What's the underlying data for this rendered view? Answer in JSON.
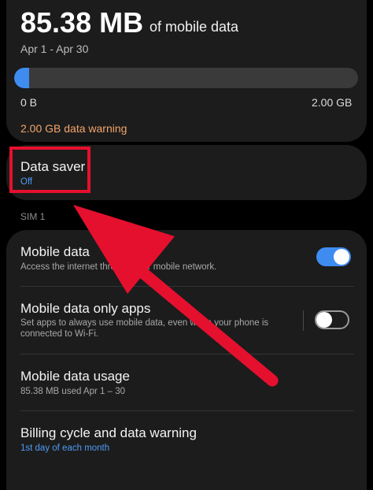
{
  "summary": {
    "amount": "85.38 MB",
    "amount_suffix": "of mobile data",
    "period": "Apr 1 - Apr 30",
    "usage_fraction": 0.043,
    "scale_min": "0 B",
    "scale_max": "2.00 GB",
    "warning": "2.00 GB data warning"
  },
  "data_saver": {
    "title": "Data saver",
    "status": "Off"
  },
  "sim_label": "SIM 1",
  "settings": [
    {
      "title": "Mobile data",
      "subtitle": "Access the internet through your mobile network.",
      "toggle": "on"
    },
    {
      "title": "Mobile data only apps",
      "subtitle": "Set apps to always use mobile data, even when your phone is connected to Wi-Fi.",
      "toggle": "off"
    },
    {
      "title": "Mobile data usage",
      "subtitle": "85.38 MB used Apr 1 – 30"
    },
    {
      "title": "Billing cycle and data warning",
      "subtitle": "1st day of each month"
    }
  ],
  "colors": {
    "accent": "#3f8cf1",
    "warning": "#f2a56b",
    "annotation": "#e5102e",
    "background": "#000000",
    "card": "#1c1c1c"
  }
}
